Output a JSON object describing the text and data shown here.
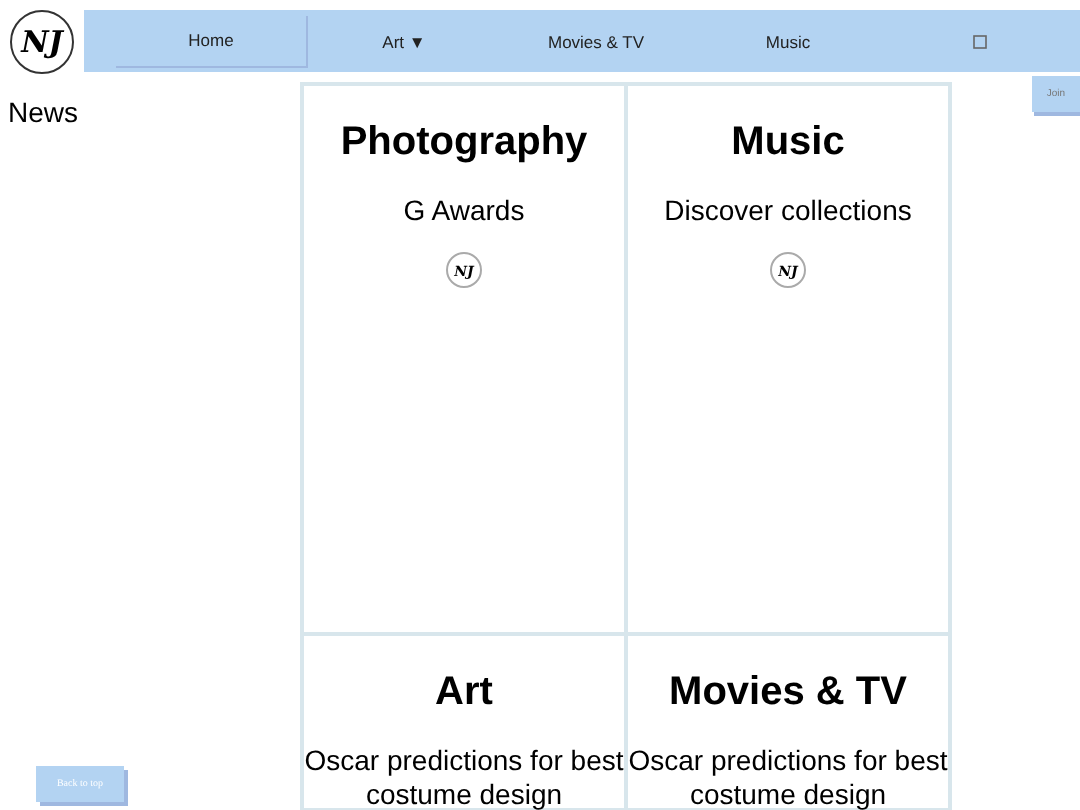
{
  "logo": "NJ",
  "nav": [
    {
      "label": "Home",
      "selected": true
    },
    {
      "label": "Art ▼",
      "selected": false
    },
    {
      "label": "Movies & TV",
      "selected": false
    },
    {
      "label": "Music",
      "selected": false
    },
    {
      "kind": "icon",
      "selected": false
    }
  ],
  "side_heading": "News",
  "join_button": "Join",
  "cards": [
    {
      "title": "Photography",
      "subtitle": "G Awards",
      "logo": "NJ"
    },
    {
      "title": "Music",
      "subtitle": "Discover collections",
      "logo": "NJ"
    },
    {
      "title": "Art",
      "subtitle": "Oscar predictions for best costume design"
    },
    {
      "title": "Movies & TV",
      "subtitle": "Oscar predictions for best costume design"
    }
  ],
  "back_to_top": "Back to top"
}
